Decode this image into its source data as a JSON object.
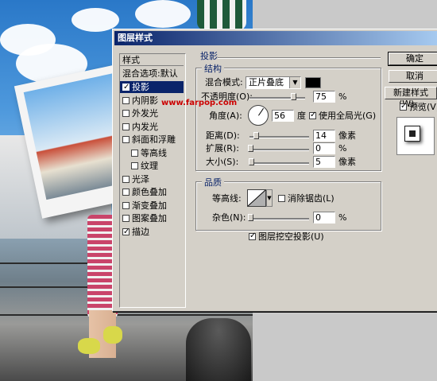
{
  "dialog": {
    "title": "图层样式"
  },
  "watermark": "www.farpop.com",
  "styles_list": {
    "header": "样式",
    "blend_options": "混合选项:默认",
    "items": [
      {
        "label": "投影",
        "checked": true,
        "selected": true
      },
      {
        "label": "内阴影",
        "checked": false
      },
      {
        "label": "外发光",
        "checked": false
      },
      {
        "label": "内发光",
        "checked": false
      },
      {
        "label": "斜面和浮雕",
        "checked": false
      },
      {
        "label": "等高线",
        "checked": false
      },
      {
        "label": "纹理",
        "checked": false
      },
      {
        "label": "光泽",
        "checked": false
      },
      {
        "label": "颜色叠加",
        "checked": false
      },
      {
        "label": "渐变叠加",
        "checked": false
      },
      {
        "label": "图案叠加",
        "checked": false
      },
      {
        "label": "描边",
        "checked": true
      }
    ]
  },
  "drop_shadow": {
    "section_title": "投影",
    "structure_title": "结构",
    "blend_mode_label": "混合模式:",
    "blend_mode_value": "正片叠底",
    "shadow_color": "#000000",
    "opacity_label": "不透明度(O):",
    "opacity_value": "75",
    "opacity_unit": "%",
    "angle_label": "角度(A):",
    "angle_value": "56",
    "angle_unit": "度",
    "global_light_label": "使用全局光(G)",
    "global_light_checked": true,
    "distance_label": "距离(D):",
    "distance_value": "14",
    "distance_unit": "像素",
    "spread_label": "扩展(R):",
    "spread_value": "0",
    "spread_unit": "%",
    "size_label": "大小(S):",
    "size_value": "5",
    "size_unit": "像素",
    "quality_title": "品质",
    "contour_label": "等高线:",
    "anti_alias_label": "消除锯齿(L)",
    "anti_alias_checked": false,
    "noise_label": "杂色(N):",
    "noise_value": "0",
    "noise_unit": "%",
    "knockout_label": "图层挖空投影(U)",
    "knockout_checked": true
  },
  "buttons": {
    "ok": "确定",
    "cancel": "取消",
    "new_style": "新建样式(W)...",
    "preview_label": "预览(V)",
    "preview_checked": true
  }
}
